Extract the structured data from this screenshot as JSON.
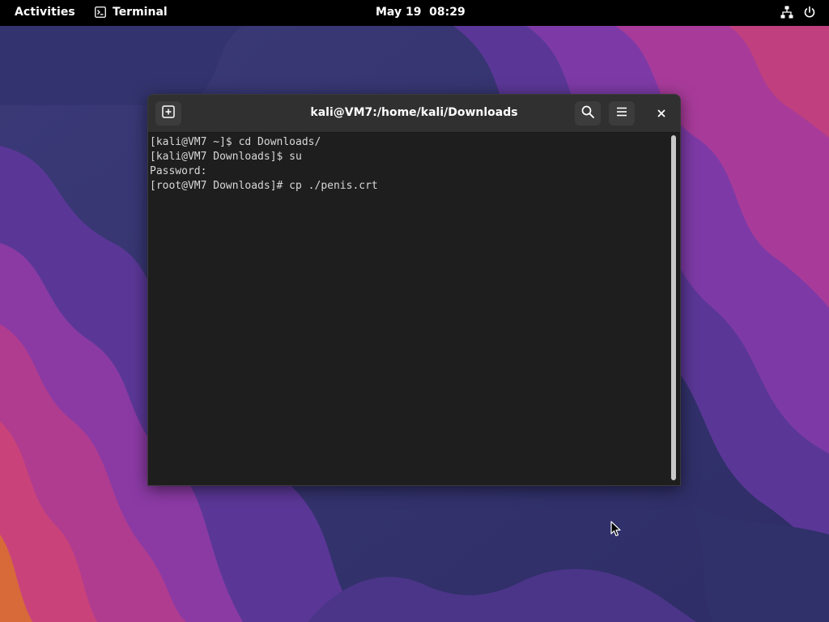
{
  "topbar": {
    "activities_label": "Activities",
    "app_name": "Terminal",
    "clock": "May 19  08:29",
    "icons": [
      "terminal-icon",
      "network-icon",
      "power-icon"
    ]
  },
  "window": {
    "title": "kali@VM7:/home/kali/Downloads",
    "buttons": [
      "new-tab-icon",
      "search-icon",
      "hamburger-menu-icon",
      "close-icon"
    ]
  },
  "terminal": {
    "lines": [
      "[kali@VM7 ~]$ cd Downloads/",
      "[kali@VM7 Downloads]$ su",
      "Password:",
      "[root@VM7 Downloads]# cp ./penis.crt"
    ]
  },
  "colors": {
    "topbar_bg": "#000000",
    "headerbar_bg": "#303030",
    "terminal_bg": "#1e1e1e",
    "terminal_fg": "#d8d8d8",
    "wallpaper_dark": "#3a2f6e",
    "wallpaper_purple": "#7a3aa8",
    "wallpaper_magenta": "#b83a8e",
    "wallpaper_orange": "#d8603a"
  }
}
